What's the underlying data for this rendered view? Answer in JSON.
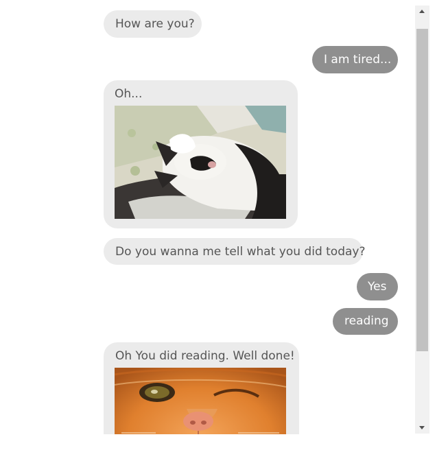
{
  "colors": {
    "bot_bubble": "#ebebeb",
    "bot_text": "#555555",
    "user_bubble": "#8f8f8f",
    "user_text": "#ffffff",
    "scroll_track": "#f1f1f1",
    "scroll_thumb": "#c1c1c1"
  },
  "messages": [
    {
      "from": "bot",
      "text": "How are you?"
    },
    {
      "from": "user",
      "text": "I am tired..."
    },
    {
      "from": "bot",
      "text": "Oh...",
      "image": "sleeping-cat-photo"
    },
    {
      "from": "bot",
      "text": "Do you wanna me tell what you did today?"
    },
    {
      "from": "user",
      "text": "Yes"
    },
    {
      "from": "user",
      "text": "reading"
    },
    {
      "from": "bot",
      "text": "Oh You did reading. Well done!",
      "image": "winking-orange-cat-photo"
    }
  ],
  "scrollbar": {
    "up_icon": "arrow-up-icon",
    "down_icon": "arrow-down-icon"
  }
}
